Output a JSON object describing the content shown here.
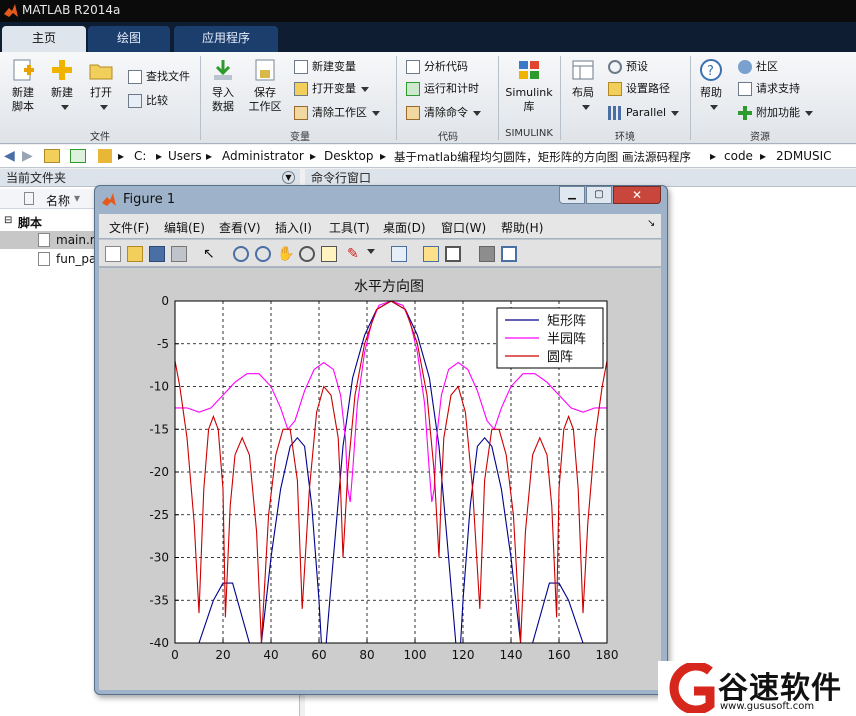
{
  "app": {
    "title": "MATLAB R2014a"
  },
  "tabs": [
    {
      "label": "主页"
    },
    {
      "label": "绘图"
    },
    {
      "label": "应用程序"
    }
  ],
  "ribbon": {
    "new_script": "新建\n脚本",
    "new": "新建",
    "open": "打开",
    "find_files": "查找文件",
    "compare": "比较",
    "import": "导入\n数据",
    "save_ws": "保存\n工作区",
    "new_var": "新建变量",
    "open_var": "打开变量",
    "clear_ws": "清除工作区",
    "analyze": "分析代码",
    "run_time": "运行和计时",
    "clear_cmd": "清除命令",
    "simulink": "Simulink\n库",
    "layout": "布局",
    "preferences": "预设",
    "set_path": "设置路径",
    "parallel": "Parallel",
    "help": "帮助",
    "community": "社区",
    "support": "请求支持",
    "addons": "附加功能",
    "groups": {
      "file": "文件",
      "variable": "变量",
      "code": "代码",
      "simulink": "SIMULINK",
      "env": "环境",
      "resources": "资源"
    }
  },
  "address": {
    "crumbs": [
      "C:",
      "Users",
      "Administrator",
      "Desktop",
      "基于matlab编程均匀圆阵，矩形阵的方向图 画法源码程序",
      "code",
      "2DMUSIC"
    ]
  },
  "current_folder": {
    "title": "当前文件夹",
    "col_name": "名称",
    "section": "脚本",
    "files": [
      "main.m",
      "fun_pa"
    ]
  },
  "command_window": {
    "title": "命令行窗口"
  },
  "figure": {
    "title": "Figure 1",
    "menus": [
      "文件(F)",
      "编辑(E)",
      "查看(V)",
      "插入(I)",
      "工具(T)",
      "桌面(D)",
      "窗口(W)",
      "帮助(H)"
    ]
  },
  "watermark": {
    "brand": "谷速软件",
    "url": "www.gususoft.com"
  },
  "colors": {
    "ribbon_tab": "#1c3e6c",
    "series_rect": "#00008b",
    "series_semi": "#ff00ff",
    "series_circ": "#cc0000"
  },
  "chart_data": {
    "type": "line",
    "title": "水平方向图",
    "xlabel": "",
    "ylabel": "",
    "xlim": [
      0,
      180
    ],
    "ylim": [
      -40,
      0
    ],
    "xticks": [
      0,
      20,
      40,
      60,
      80,
      100,
      120,
      140,
      160,
      180
    ],
    "yticks": [
      0,
      -5,
      -10,
      -15,
      -20,
      -25,
      -30,
      -35,
      -40
    ],
    "grid": true,
    "legend_position": "top-right",
    "series": [
      {
        "name": "矩形阵",
        "color": "#00008b",
        "points": [
          [
            0,
            -40
          ],
          [
            4,
            -40
          ],
          [
            10,
            -40
          ],
          [
            16,
            -35
          ],
          [
            20,
            -33
          ],
          [
            24,
            -33
          ],
          [
            28,
            -37
          ],
          [
            31,
            -40
          ],
          [
            36,
            -40
          ],
          [
            40,
            -30
          ],
          [
            44,
            -22
          ],
          [
            48,
            -17
          ],
          [
            51,
            -16
          ],
          [
            54,
            -17
          ],
          [
            57,
            -24
          ],
          [
            60,
            -35
          ],
          [
            61,
            -40
          ],
          [
            63,
            -40
          ],
          [
            66,
            -30
          ],
          [
            70,
            -17
          ],
          [
            74,
            -9
          ],
          [
            79,
            -4
          ],
          [
            84,
            -1
          ],
          [
            90,
            0
          ],
          [
            96,
            -1
          ],
          [
            101,
            -4
          ],
          [
            106,
            -9
          ],
          [
            110,
            -17
          ],
          [
            114,
            -30
          ],
          [
            117,
            -40
          ],
          [
            119,
            -40
          ],
          [
            120,
            -35
          ],
          [
            123,
            -24
          ],
          [
            126,
            -17
          ],
          [
            129,
            -16
          ],
          [
            132,
            -17
          ],
          [
            136,
            -22
          ],
          [
            140,
            -30
          ],
          [
            144,
            -40
          ],
          [
            149,
            -40
          ],
          [
            152,
            -37
          ],
          [
            156,
            -33
          ],
          [
            160,
            -33
          ],
          [
            164,
            -35
          ],
          [
            170,
            -40
          ],
          [
            180,
            -40
          ]
        ]
      },
      {
        "name": "半园阵",
        "color": "#ff00ff",
        "points": [
          [
            0,
            -12.5
          ],
          [
            5,
            -12.5
          ],
          [
            10,
            -13
          ],
          [
            15,
            -12.5
          ],
          [
            20,
            -11
          ],
          [
            25,
            -9.5
          ],
          [
            30,
            -8.5
          ],
          [
            35,
            -8.5
          ],
          [
            40,
            -10
          ],
          [
            44,
            -12.5
          ],
          [
            47,
            -15
          ],
          [
            50,
            -14
          ],
          [
            54,
            -10.5
          ],
          [
            58,
            -8
          ],
          [
            62,
            -7.2
          ],
          [
            66,
            -8
          ],
          [
            69,
            -11
          ],
          [
            71,
            -16
          ],
          [
            72,
            -22
          ],
          [
            73,
            -23.5
          ],
          [
            74,
            -20
          ],
          [
            76,
            -12
          ],
          [
            79,
            -6
          ],
          [
            82,
            -2.5
          ],
          [
            85,
            -0.5
          ],
          [
            90,
            0
          ],
          [
            95,
            -0.5
          ],
          [
            98,
            -2.5
          ],
          [
            101,
            -6
          ],
          [
            104,
            -12
          ],
          [
            106,
            -20
          ],
          [
            107,
            -23.5
          ],
          [
            108,
            -22
          ],
          [
            109,
            -16
          ],
          [
            111,
            -11
          ],
          [
            114,
            -8
          ],
          [
            118,
            -7.2
          ],
          [
            122,
            -8
          ],
          [
            126,
            -10.5
          ],
          [
            130,
            -14
          ],
          [
            133,
            -15
          ],
          [
            136,
            -12.5
          ],
          [
            140,
            -10
          ],
          [
            145,
            -8.5
          ],
          [
            150,
            -8.5
          ],
          [
            155,
            -9.5
          ],
          [
            160,
            -11
          ],
          [
            165,
            -12.5
          ],
          [
            170,
            -13
          ],
          [
            175,
            -12.5
          ],
          [
            180,
            -12.5
          ]
        ]
      },
      {
        "name": "圆阵",
        "color": "#cc0000",
        "points": [
          [
            0,
            -7
          ],
          [
            2,
            -10
          ],
          [
            5,
            -16
          ],
          [
            8,
            -26
          ],
          [
            10,
            -36.5
          ],
          [
            12,
            -22
          ],
          [
            14,
            -15
          ],
          [
            16,
            -13.5
          ],
          [
            18,
            -15
          ],
          [
            20,
            -22
          ],
          [
            21,
            -37
          ],
          [
            23,
            -24
          ],
          [
            25,
            -18
          ],
          [
            28,
            -16
          ],
          [
            31,
            -18
          ],
          [
            34,
            -27
          ],
          [
            36,
            -40
          ],
          [
            39,
            -25
          ],
          [
            42,
            -18
          ],
          [
            45,
            -15
          ],
          [
            48,
            -15
          ],
          [
            51,
            -21
          ],
          [
            53,
            -36
          ],
          [
            56,
            -22
          ],
          [
            59,
            -13
          ],
          [
            62,
            -10
          ],
          [
            65,
            -11
          ],
          [
            68,
            -16
          ],
          [
            69,
            -22
          ],
          [
            70,
            -30
          ],
          [
            72,
            -20
          ],
          [
            75,
            -11
          ],
          [
            79,
            -5
          ],
          [
            84,
            -1
          ],
          [
            90,
            0
          ],
          [
            96,
            -1
          ],
          [
            101,
            -5
          ],
          [
            105,
            -11
          ],
          [
            108,
            -20
          ],
          [
            110,
            -30
          ],
          [
            111,
            -22
          ],
          [
            112,
            -16
          ],
          [
            115,
            -11
          ],
          [
            118,
            -10
          ],
          [
            121,
            -13
          ],
          [
            124,
            -22
          ],
          [
            127,
            -36
          ],
          [
            129,
            -21
          ],
          [
            132,
            -15
          ],
          [
            135,
            -15
          ],
          [
            138,
            -18
          ],
          [
            141,
            -25
          ],
          [
            144,
            -40
          ],
          [
            146,
            -27
          ],
          [
            149,
            -18
          ],
          [
            152,
            -16
          ],
          [
            155,
            -18
          ],
          [
            157,
            -24
          ],
          [
            159,
            -37
          ],
          [
            160,
            -22
          ],
          [
            162,
            -15
          ],
          [
            164,
            -13.5
          ],
          [
            166,
            -15
          ],
          [
            168,
            -22
          ],
          [
            170,
            -36.5
          ],
          [
            172,
            -26
          ],
          [
            175,
            -16
          ],
          [
            178,
            -10
          ],
          [
            180,
            -7
          ]
        ]
      }
    ]
  }
}
